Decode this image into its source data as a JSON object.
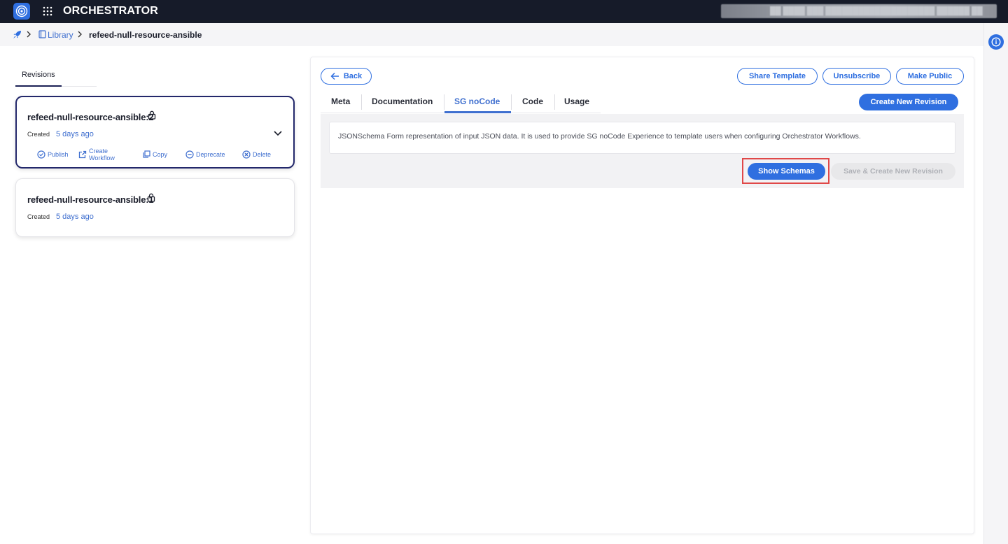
{
  "app": {
    "title": "ORCHESTRATOR",
    "user_info": "██ ████ ███ ████████████████████ ██████ ██"
  },
  "breadcrumb": {
    "library": "Library",
    "current": "refeed-null-resource-ansible"
  },
  "revisions": {
    "tab_label": "Revisions",
    "items": [
      {
        "name": "refeed-null-resource-ansible:2",
        "created_label": "Created",
        "created_value": "5 days ago",
        "actions": {
          "publish": "Publish",
          "create_workflow_1": "Create",
          "create_workflow_2": "Workflow",
          "copy": "Copy",
          "deprecate": "Deprecate",
          "delete": "Delete"
        }
      },
      {
        "name": "refeed-null-resource-ansible:1",
        "created_label": "Created",
        "created_value": "5 days ago"
      }
    ]
  },
  "toolbar": {
    "back": "Back",
    "share": "Share Template",
    "unsubscribe": "Unsubscribe",
    "make_public": "Make Public",
    "create_revision": "Create New Revision"
  },
  "tabs": [
    "Meta",
    "Documentation",
    "SG noCode",
    "Code",
    "Usage"
  ],
  "content": {
    "description": "JSONSchema Form representation of input JSON data. It is used to provide SG noCode Experience to template users when configuring Orchestrator Workflows.",
    "show_schemas": "Show Schemas",
    "save_create": "Save & Create New Revision"
  },
  "colors": {
    "accent": "#2f6fe0",
    "topbar": "#161b29",
    "active_card_border": "#23286b",
    "highlight": "#e04848"
  }
}
